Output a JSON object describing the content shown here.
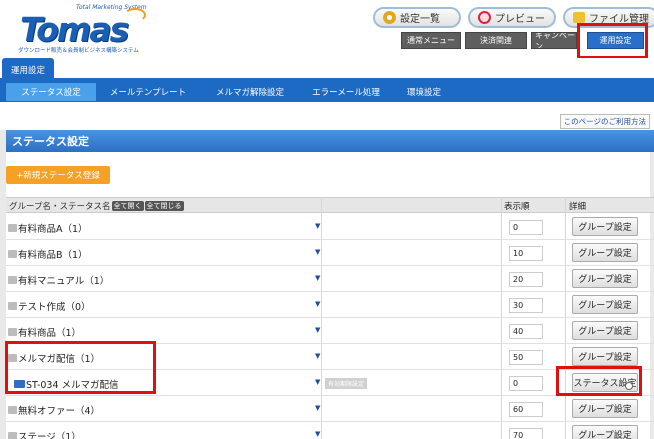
{
  "header": {
    "logo_text": "Tomas",
    "logo_tagline": "Total Marketing System",
    "logo_subtitle": "ダウンロード販売＆会員制ビジネス構築システム",
    "top_buttons": [
      "設定一覧",
      "プレビュー",
      "ファイル管理"
    ],
    "menu_buttons": [
      "通常メニュー",
      "決済関連",
      "キャンペーン",
      "運用設定"
    ]
  },
  "tabs": {
    "active": "運用設定"
  },
  "subnav": [
    "ステータス設定",
    "メールテンプレート",
    "メルマガ解除設定",
    "エラーメール処理",
    "環境設定"
  ],
  "help_link": "このページのご利用方法",
  "section_title": "ステータス設定",
  "new_button": "+新規ステータス登録",
  "table": {
    "col_name": "グループ名・ステータス名",
    "expand_all": "全て開く",
    "collapse_all": "全て閉じる",
    "col_order": "表示順",
    "col_detail": "詳細",
    "rows": [
      {
        "name": "有料商品A（1）",
        "order": "0",
        "button": "グループ設定"
      },
      {
        "name": "有料商品B（1）",
        "order": "10",
        "button": "グループ設定"
      },
      {
        "name": "有料マニュアル（1）",
        "order": "20",
        "button": "グループ設定"
      },
      {
        "name": "テスト作成（0）",
        "order": "30",
        "button": "グループ設定"
      },
      {
        "name": "有料商品（1）",
        "order": "40",
        "button": "グループ設定"
      },
      {
        "name": "メルマガ配信（1）",
        "order": "50",
        "button": "グループ設定"
      },
      {
        "name": "ST-034 メルマガ配信",
        "order": "0",
        "button": "ステータス設定",
        "tag": "有効期限設定"
      },
      {
        "name": "無料オファー（4）",
        "order": "60",
        "button": "グループ設定"
      },
      {
        "name": "ステージ（1）",
        "order": "70",
        "button": "グループ設定"
      }
    ]
  }
}
